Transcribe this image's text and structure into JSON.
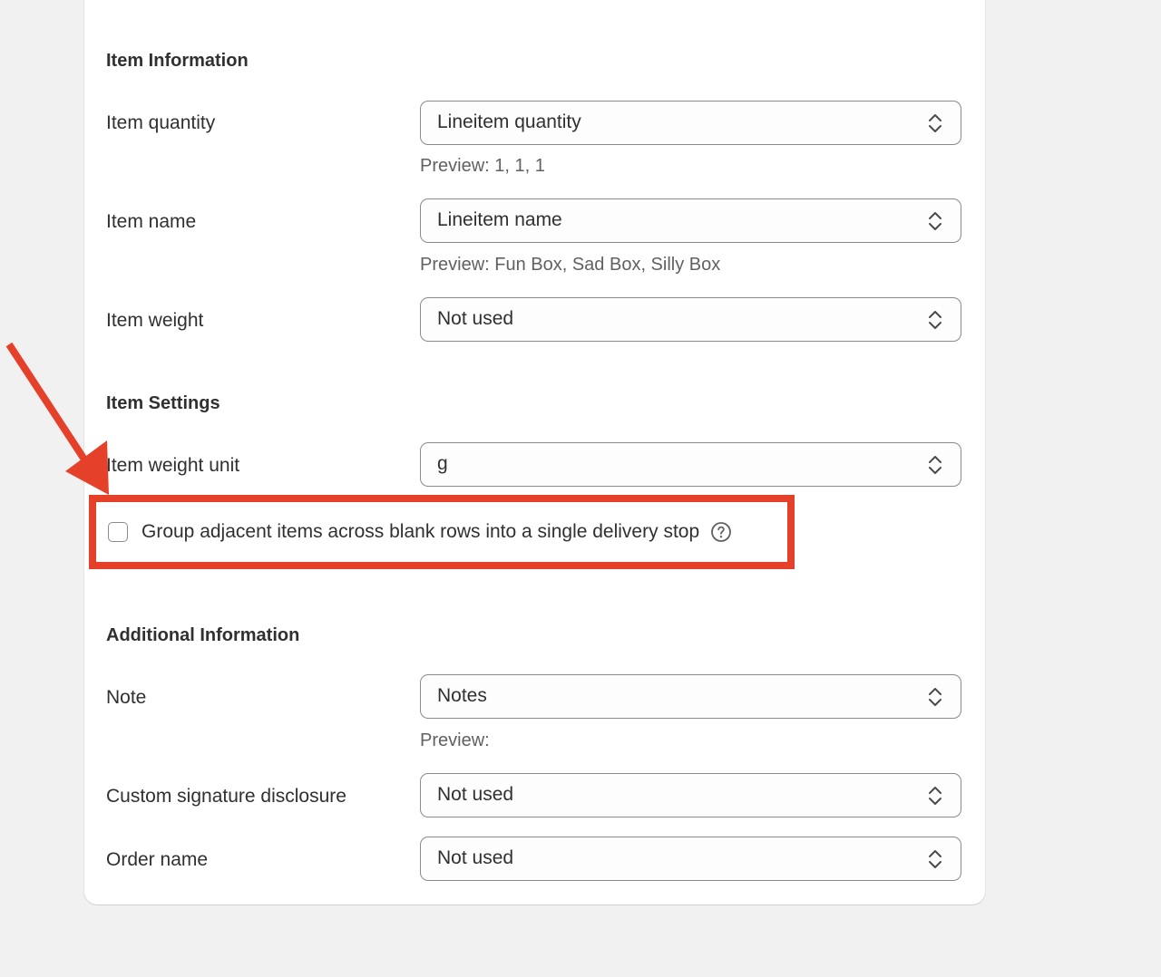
{
  "sections": {
    "item_information": {
      "title": "Item Information",
      "rows": [
        {
          "label": "Item quantity",
          "value": "Lineitem quantity",
          "preview": "Preview: 1, 1, 1"
        },
        {
          "label": "Item name",
          "value": "Lineitem name",
          "preview": "Preview: Fun Box, Sad Box, Silly Box"
        },
        {
          "label": "Item weight",
          "value": "Not used"
        }
      ]
    },
    "item_settings": {
      "title": "Item Settings",
      "rows": [
        {
          "label": "Item weight unit",
          "value": "g"
        }
      ],
      "checkbox": {
        "label": "Group adjacent items across blank rows into a single delivery stop",
        "checked": false
      }
    },
    "additional_information": {
      "title": "Additional Information",
      "rows": [
        {
          "label": "Note",
          "value": "Notes",
          "preview": "Preview:"
        },
        {
          "label": "Custom signature disclosure",
          "value": "Not used"
        },
        {
          "label": "Order name",
          "value": "Not used"
        }
      ]
    }
  },
  "colors": {
    "highlight": "#e5412a",
    "background": "#f1f1f1",
    "card": "#ffffff",
    "text": "#303030",
    "muted_text": "#616161"
  },
  "icons": {
    "select_arrows": "chevron-up-down-icon",
    "help": "question-circle-icon",
    "annotation": "red-arrow"
  }
}
